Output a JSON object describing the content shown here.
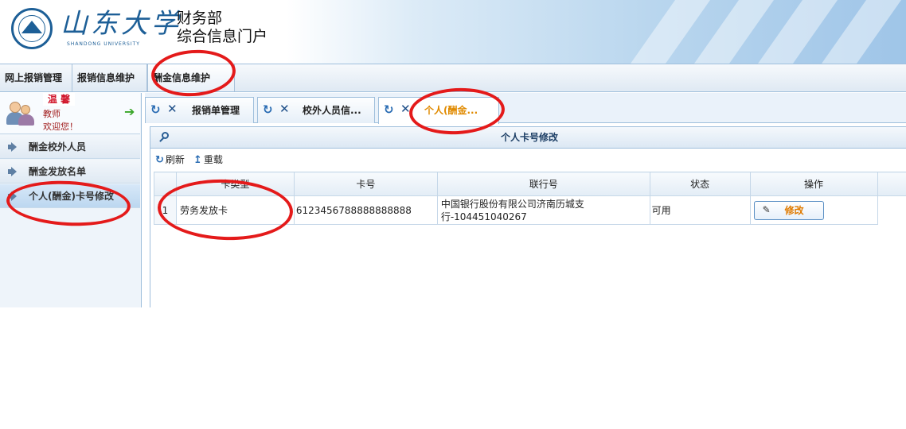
{
  "header": {
    "logo_text": "山东大学",
    "logo_en": "SHANDONG UNIVERSITY",
    "seal_year": "1901",
    "department": "财务部",
    "portal_name": "综合信息门户"
  },
  "top_menu": [
    {
      "label": "网上报销管理"
    },
    {
      "label": "报销信息维护"
    },
    {
      "label": "酬金信息维护"
    }
  ],
  "user": {
    "name": "温 馨",
    "role": "教师",
    "welcome": "欢迎您！"
  },
  "sidebar": {
    "items": [
      {
        "label": "酬金校外人员"
      },
      {
        "label": "酬金发放名单"
      },
      {
        "label": "个人(酬金)卡号修改"
      }
    ]
  },
  "tabs": [
    {
      "label": "报销单管理"
    },
    {
      "label": "校外人员信..."
    },
    {
      "label": "个人(酬金..."
    }
  ],
  "panel": {
    "title": "个人卡号修改",
    "refresh_label": "刷新",
    "reload_label": "重载"
  },
  "table": {
    "columns": [
      "卡类型",
      "卡号",
      "联行号",
      "状态",
      "操作"
    ],
    "rows": [
      {
        "num": "1",
        "card_type": "劳务发放卡",
        "card_no": "6123456788888888888",
        "bank_line1": "中国银行股份有限公司济南历城支",
        "bank_line2": "行-104451040267",
        "status": "可用",
        "action": "修改"
      }
    ]
  },
  "colors": {
    "accent": "#e08a00",
    "annotation": "#e41a1a",
    "brand": "#1d5f97"
  }
}
